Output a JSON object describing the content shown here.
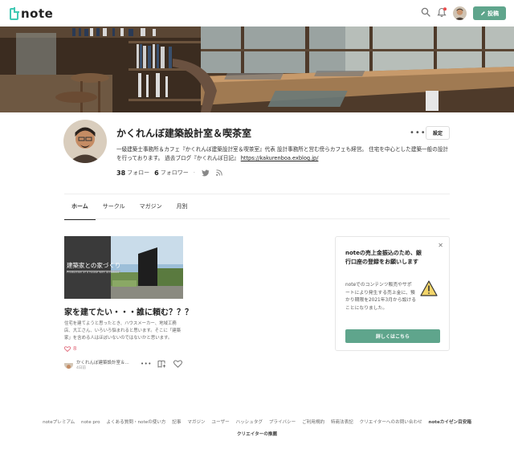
{
  "header": {
    "logo_text": "note",
    "post_label": "投稿",
    "accent_color": "#5fa58c"
  },
  "profile": {
    "name": "かくれんぼ建築設計室＆喫茶室",
    "settings_label": "設定",
    "more_label": "•••",
    "bio": "一級建築士事務所＆カフェ『かくれんぼ建築設計室＆喫茶室』代表 設計事務所と営む傍らカフェも経営。 住宅を中心とした建築一般の設計を行っております。 過去ブログ『かくれんぼ日記』",
    "blog_link": "https://kakurenboa.exblog.jp/",
    "following_count": "38",
    "following_label": "フォロー",
    "followers_count": "6",
    "followers_label": "フォロワー"
  },
  "tabs": [
    {
      "label": "ホーム"
    },
    {
      "label": "サークル"
    },
    {
      "label": "マガジン"
    },
    {
      "label": "月別"
    }
  ],
  "article": {
    "thumb_title": "建築家との家づくり",
    "thumb_subtitle": "Production of a house with Architect",
    "title": "家を建てたい・・・誰に頼む？？？",
    "excerpt": "住宅を建てようと思ったとき、ハウスメーカー、地域工務店、大工さん、いろいろ悩まれると思います。そこに「建築家」を含める人はほぼいないのではないかと思います。",
    "likes": "8",
    "author": "かくれんぼ建築設計室＆...",
    "time": "4日前"
  },
  "notice": {
    "title": "noteの売上金振込のため、銀行口座の登録をお願いします",
    "body": "noteでのコンテンツ販売やサポートにより発生する売上金に、預かり期限を2021年3月から設けることになりました。",
    "button": "詳しくはこちら"
  },
  "footer": {
    "links": [
      "noteプレミアム",
      "note pro",
      "よくある質問・noteの使い方",
      "記事",
      "マガジン",
      "ユーザー",
      "ハッシュタグ",
      "プライバシー",
      "ご利用規約",
      "特商法表記",
      "クリエイターへのお問い合わせ"
    ],
    "kaizen": "noteカイゼン目安箱",
    "creator_recommend": "クリエイターの推薦"
  }
}
